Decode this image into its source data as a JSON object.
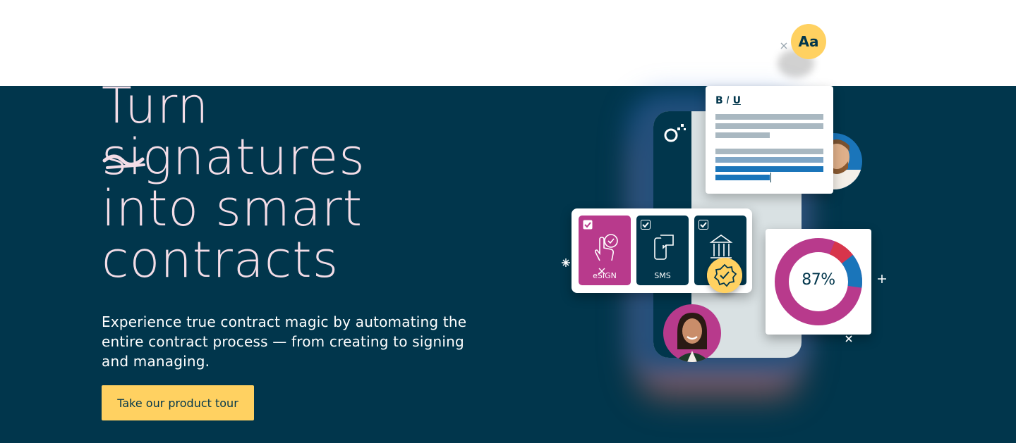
{
  "hero": {
    "headline": [
      "Turn",
      "signatures",
      "into smart",
      "contracts"
    ],
    "description": "Experience true contract magic by automating the entire contract process — from creating to signing and managing.",
    "cta_label": "Take our product tour"
  },
  "illustration": {
    "font_badge_text": "Aa",
    "editor_toolbar": {
      "bold": "B",
      "italic": "I",
      "underline": "U"
    },
    "signing_options": [
      {
        "label": "eSIGN",
        "icon": "hand-tap-check-icon",
        "checked": true
      },
      {
        "label": "SMS",
        "icon": "phone-message-icon",
        "checked": true
      },
      {
        "label": "",
        "icon": "bank-icon",
        "checked": true
      }
    ],
    "completion": {
      "label": "87%",
      "fraction": 0.87
    },
    "icons": [
      "logo-mark-icon",
      "verified-badge-icon",
      "sparkle-icon",
      "checkbox-icon"
    ]
  },
  "colors": {
    "background": "#01364c",
    "headline": "#f3dde7",
    "accent_yellow": "#ffd161",
    "accent_magenta": "#b83a8c",
    "accent_blue": "#1a75ba",
    "accent_red": "#d7354b"
  }
}
